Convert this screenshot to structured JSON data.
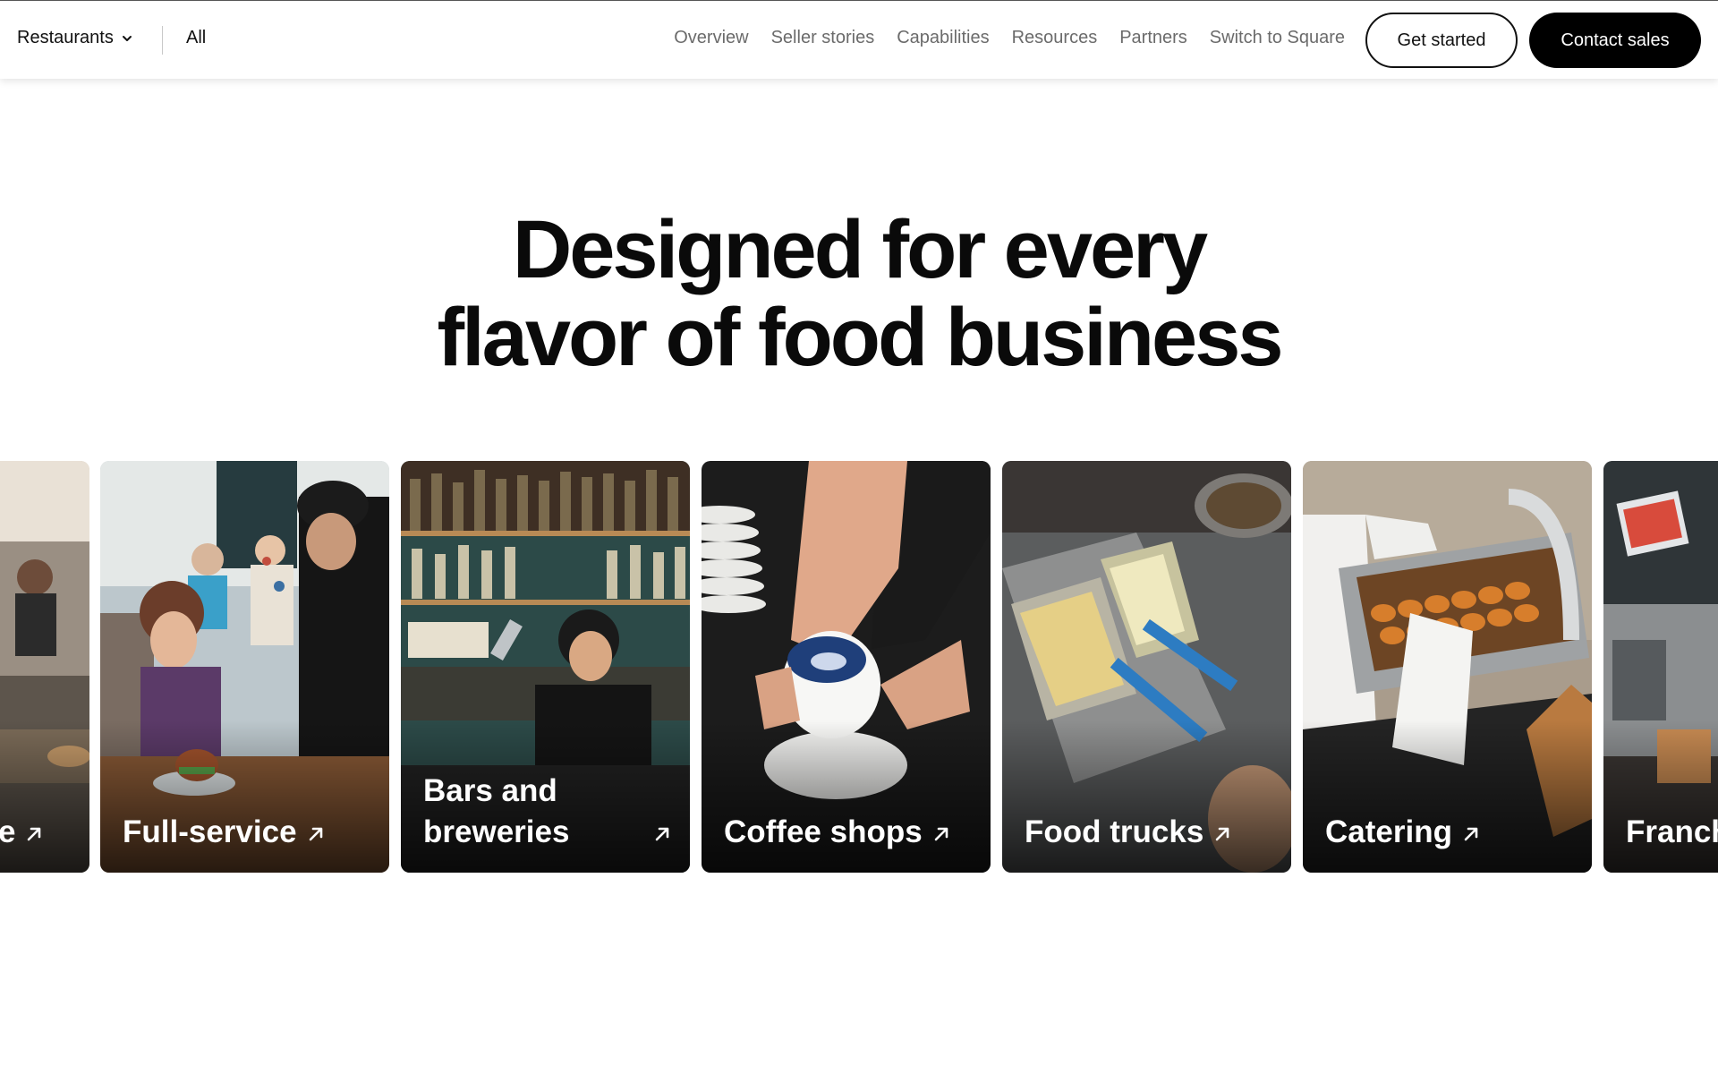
{
  "nav": {
    "category_select": "Restaurants",
    "all_link": "All",
    "links": [
      "Overview",
      "Seller stories",
      "Capabilities",
      "Resources",
      "Partners",
      "Switch to Square"
    ],
    "get_started": "Get started",
    "contact_sales": "Contact sales"
  },
  "hero": {
    "line1": "Designed for every",
    "line2": "flavor of food business"
  },
  "cards": [
    {
      "label": "e"
    },
    {
      "label": "Full-service"
    },
    {
      "label": "Bars and breweries"
    },
    {
      "label": "Coffee shops"
    },
    {
      "label": "Food trucks"
    },
    {
      "label": "Catering"
    },
    {
      "label": "Franch"
    }
  ],
  "colors": {
    "text_primary": "#000000",
    "nav_link": "#6b6b6b",
    "button_dark": "#000000"
  },
  "icons": {
    "dropdown": "chevron-down-icon",
    "card_link": "arrow-up-right-icon"
  }
}
